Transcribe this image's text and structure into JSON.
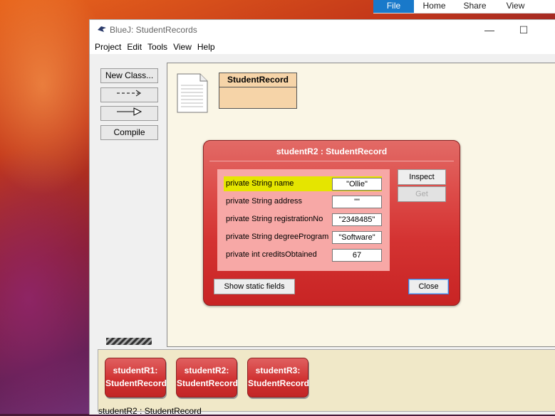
{
  "explorer_ribbon": {
    "tabs": [
      "File",
      "Home",
      "Share",
      "View"
    ]
  },
  "window": {
    "title": "BlueJ:  StudentRecords",
    "controls": {
      "minimize": "—",
      "maximize": "☐",
      "close": "✕"
    }
  },
  "menu": [
    "Project",
    "Edit",
    "Tools",
    "View",
    "Help"
  ],
  "toolbar": {
    "new_class": "New Class...",
    "compile": "Compile"
  },
  "diagram": {
    "class_name": "StudentRecord"
  },
  "inspector": {
    "title": "studentR2 : StudentRecord",
    "fields": [
      {
        "label": "private String name",
        "value": "\"Ollie\"",
        "selected": true
      },
      {
        "label": "private String address",
        "value": "\"\""
      },
      {
        "label": "private String registrationNo",
        "value": "\"2348485\""
      },
      {
        "label": "private String degreeProgram",
        "value": "\"Software\""
      },
      {
        "label": "private int creditsObtained",
        "value": "67"
      }
    ],
    "inspect_label": "Inspect",
    "get_label": "Get",
    "static_fields_label": "Show static fields",
    "close_label": "Close"
  },
  "object_bench": [
    {
      "name": "studentR1:",
      "type": "StudentRecord"
    },
    {
      "name": "studentR2:",
      "type": "StudentRecord"
    },
    {
      "name": "studentR3:",
      "type": "StudentRecord"
    }
  ],
  "status": "studentR2 : StudentRecord",
  "colors": {
    "inspector": "#d43332",
    "field_selected": "#e5e500",
    "class_box": "#f6d4a8",
    "file_tab": "#1979ca"
  }
}
